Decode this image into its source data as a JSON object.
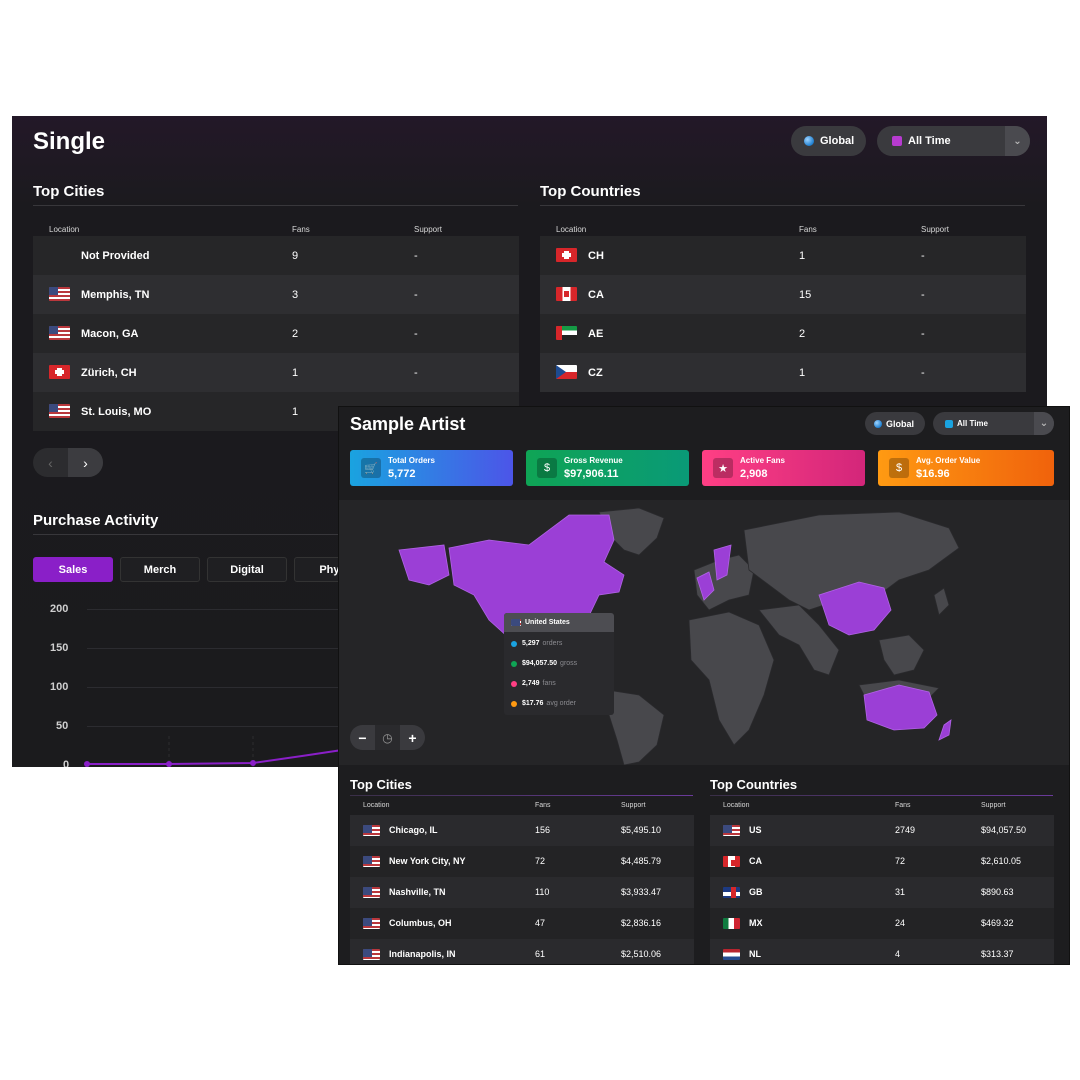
{
  "back": {
    "title": "Single",
    "global_label": "Global",
    "range_label": "All Time",
    "top_cities": {
      "title": "Top Cities",
      "headers": [
        "Location",
        "Fans",
        "Support"
      ],
      "rows": [
        {
          "flag": "none",
          "location": "Not Provided",
          "fans": "9",
          "support": "-"
        },
        {
          "flag": "us",
          "location": "Memphis, TN",
          "fans": "3",
          "support": "-"
        },
        {
          "flag": "us",
          "location": "Macon, GA",
          "fans": "2",
          "support": "-"
        },
        {
          "flag": "ch",
          "location": "Zürich, CH",
          "fans": "1",
          "support": "-"
        },
        {
          "flag": "us",
          "location": "St. Louis, MO",
          "fans": "1",
          "support": "-"
        }
      ]
    },
    "top_countries": {
      "title": "Top Countries",
      "headers": [
        "Location",
        "Fans",
        "Support"
      ],
      "rows": [
        {
          "flag": "ch",
          "location": "CH",
          "fans": "1",
          "support": "-"
        },
        {
          "flag": "ca",
          "location": "CA",
          "fans": "15",
          "support": "-"
        },
        {
          "flag": "ae",
          "location": "AE",
          "fans": "2",
          "support": "-"
        },
        {
          "flag": "cz",
          "location": "CZ",
          "fans": "1",
          "support": "-"
        }
      ]
    },
    "purchase_activity": {
      "title": "Purchase Activity",
      "tabs": [
        "Sales",
        "Merch",
        "Digital",
        "Physi"
      ],
      "y_ticks": [
        "200",
        "150",
        "100",
        "50",
        "0"
      ]
    }
  },
  "front": {
    "title": "Sample Artist",
    "global_label": "Global",
    "range_label": "All Time",
    "kpis": [
      {
        "label": "Total Orders",
        "value": "5,772",
        "icon": "cart-icon"
      },
      {
        "label": "Gross Revenue",
        "value": "$97,906.11",
        "icon": "cash-icon"
      },
      {
        "label": "Active Fans",
        "value": "2,908",
        "icon": "fan-icon"
      },
      {
        "label": "Avg. Order Value",
        "value": "$16.96",
        "icon": "receipt-icon"
      }
    ],
    "tooltip": {
      "country": "United States",
      "rows": [
        {
          "value": "5,297",
          "unit": "orders",
          "color": "#1aa3e0"
        },
        {
          "value": "$94,057.50",
          "unit": "gross",
          "color": "#0fa455"
        },
        {
          "value": "2,749",
          "unit": "fans",
          "color": "#ff3f84"
        },
        {
          "value": "$17.76",
          "unit": "avg order",
          "color": "#ff9a12"
        }
      ]
    },
    "zoom": {
      "minus": "−",
      "plus": "+"
    },
    "top_cities": {
      "title": "Top Cities",
      "headers": [
        "Location",
        "Fans",
        "Support"
      ],
      "rows": [
        {
          "flag": "us",
          "location": "Chicago, IL",
          "fans": "156",
          "support": "$5,495.10"
        },
        {
          "flag": "us",
          "location": "New York City, NY",
          "fans": "72",
          "support": "$4,485.79"
        },
        {
          "flag": "us",
          "location": "Nashville, TN",
          "fans": "110",
          "support": "$3,933.47"
        },
        {
          "flag": "us",
          "location": "Columbus, OH",
          "fans": "47",
          "support": "$2,836.16"
        },
        {
          "flag": "us",
          "location": "Indianapolis, IN",
          "fans": "61",
          "support": "$2,510.06"
        }
      ]
    },
    "top_countries": {
      "title": "Top Countries",
      "headers": [
        "Location",
        "Fans",
        "Support"
      ],
      "rows": [
        {
          "flag": "us",
          "location": "US",
          "fans": "2749",
          "support": "$94,057.50"
        },
        {
          "flag": "ca",
          "location": "CA",
          "fans": "72",
          "support": "$2,610.05"
        },
        {
          "flag": "gb",
          "location": "GB",
          "fans": "31",
          "support": "$890.63"
        },
        {
          "flag": "mx",
          "location": "MX",
          "fans": "24",
          "support": "$469.32"
        },
        {
          "flag": "nl",
          "location": "NL",
          "fans": "4",
          "support": "$313.37"
        }
      ]
    }
  },
  "colors": {
    "accent": "#8a1fc8",
    "highlight_country": "#9b3fd6"
  }
}
